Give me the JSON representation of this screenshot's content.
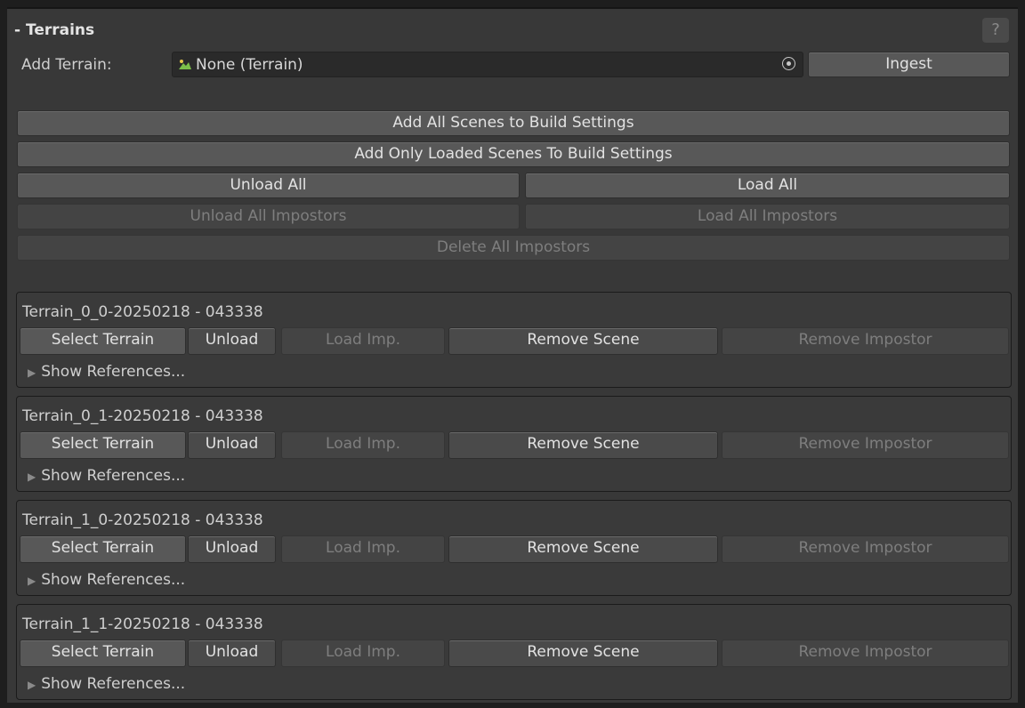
{
  "header": {
    "title": "- Terrains",
    "help_icon": "?"
  },
  "add_terrain": {
    "label": "Add Terrain:",
    "field_value": "None (Terrain)",
    "ingest_label": "Ingest"
  },
  "global_buttons": {
    "add_all_scenes": "Add All Scenes to Build Settings",
    "add_loaded_scenes": "Add Only Loaded Scenes To Build Settings",
    "unload_all": "Unload All",
    "load_all": "Load All",
    "unload_all_impostors": "Unload All Impostors",
    "load_all_impostors": "Load All Impostors",
    "delete_all_impostors": "Delete All Impostors"
  },
  "terrains": [
    {
      "name": "Terrain_0_0-20250218 - 043338",
      "select": "Select Terrain",
      "unload": "Unload",
      "load_imp": "Load Imp.",
      "remove_scene": "Remove Scene",
      "remove_impostor": "Remove Impostor",
      "show_refs": "Show References..."
    },
    {
      "name": "Terrain_0_1-20250218 - 043338",
      "select": "Select Terrain",
      "unload": "Unload",
      "load_imp": "Load Imp.",
      "remove_scene": "Remove Scene",
      "remove_impostor": "Remove Impostor",
      "show_refs": "Show References..."
    },
    {
      "name": "Terrain_1_0-20250218 - 043338",
      "select": "Select Terrain",
      "unload": "Unload",
      "load_imp": "Load Imp.",
      "remove_scene": "Remove Scene",
      "remove_impostor": "Remove Impostor",
      "show_refs": "Show References..."
    },
    {
      "name": "Terrain_1_1-20250218 - 043338",
      "select": "Select Terrain",
      "unload": "Unload",
      "load_imp": "Load Imp.",
      "remove_scene": "Remove Scene",
      "remove_impostor": "Remove Impostor",
      "show_refs": "Show References..."
    }
  ],
  "colors": {
    "panel_bg": "#383838",
    "button_bg": "#585858",
    "disabled_text": "#7e7e7e",
    "terrain_icon_green": "#7cc04a"
  }
}
